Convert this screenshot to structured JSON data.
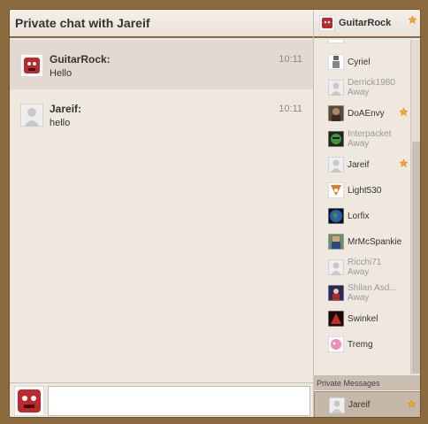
{
  "chat": {
    "title": "Private chat with Jareif",
    "messages": [
      {
        "sender": "GuitarRock:",
        "text": "Hello",
        "time": "10:11",
        "avatar": "red-monster-icon"
      },
      {
        "sender": "Jareif:",
        "text": "hello",
        "time": "10:11",
        "avatar": "default-avatar-icon"
      }
    ],
    "input": {
      "value": "",
      "placeholder": ""
    }
  },
  "me": {
    "name": "GuitarRock",
    "starred": true
  },
  "users": [
    {
      "name": "Cyriel",
      "status": "",
      "starred": false,
      "avatar": "robot-icon"
    },
    {
      "name": "Derrick1980",
      "status": "Away",
      "starred": false,
      "avatar": "default-avatar-icon"
    },
    {
      "name": "DoAEnvy",
      "status": "",
      "starred": true,
      "avatar": "warrior-icon"
    },
    {
      "name": "Interpacket",
      "status": "Away",
      "starred": false,
      "avatar": "green-mask-icon"
    },
    {
      "name": "Jareif",
      "status": "",
      "starred": true,
      "avatar": "default-avatar-icon"
    },
    {
      "name": "Light530",
      "status": "",
      "starred": false,
      "avatar": "fox-icon"
    },
    {
      "name": "Lorfix",
      "status": "",
      "starred": false,
      "avatar": "earth-icon"
    },
    {
      "name": "MrMcSpankie",
      "status": "",
      "starred": false,
      "avatar": "pixel-character-icon"
    },
    {
      "name": "Ricchi71",
      "status": "Away",
      "starred": false,
      "avatar": "default-avatar-icon"
    },
    {
      "name": "Shilan Asd...",
      "status": "Away",
      "starred": false,
      "avatar": "dark-character-icon"
    },
    {
      "name": "Swinkel",
      "status": "",
      "starred": false,
      "avatar": "red-creature-icon"
    },
    {
      "name": "Tremg",
      "status": "",
      "starred": false,
      "avatar": "pink-pony-icon"
    }
  ],
  "private_messages": {
    "label": "Private Messages",
    "items": [
      {
        "name": "Jareif",
        "starred": true,
        "avatar": "default-avatar-icon"
      }
    ]
  },
  "colors": {
    "frame": "#8b6a3e",
    "panel": "#efe8df",
    "highlight": "#e2dad0",
    "star": "#f5a623"
  }
}
